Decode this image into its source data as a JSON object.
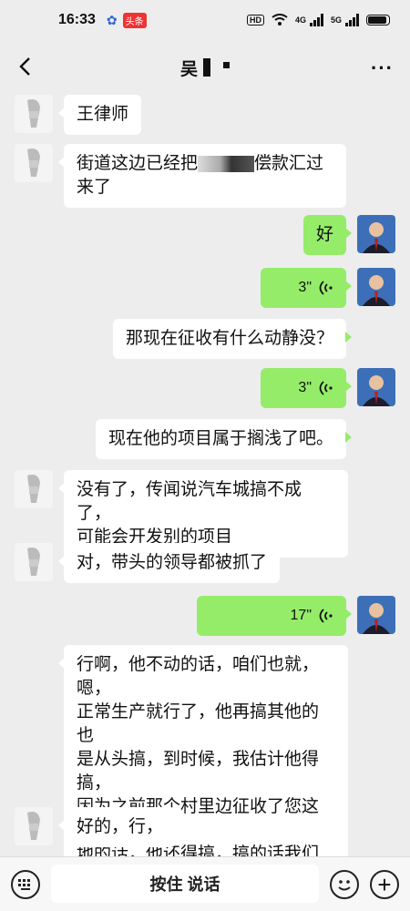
{
  "status_bar": {
    "time": "16:33",
    "app_badge": "头条",
    "network_1": "4G",
    "network_2": "5G",
    "hd_label": "HD"
  },
  "header": {
    "title": "吴"
  },
  "messages": [
    {
      "side": "left",
      "type": "text",
      "text": "王律师"
    },
    {
      "side": "left",
      "type": "text",
      "text": "街道这边已经把",
      "text_tail": "偿款汇过",
      "text_line2": "来了"
    },
    {
      "side": "right",
      "type": "text",
      "text": "好"
    },
    {
      "side": "right",
      "type": "voice",
      "duration": "3\""
    },
    {
      "side": "left",
      "type": "text",
      "text": "那现在征收有什么动静没？"
    },
    {
      "side": "right",
      "type": "voice",
      "duration": "3\""
    },
    {
      "side": "left",
      "type": "text",
      "text": "现在他的项目属于搁浅了吧。"
    },
    {
      "side": "left",
      "type": "text",
      "text": "没有了，传闻说汽车城搞不成了，\n可能会开发别的项目"
    },
    {
      "side": "left",
      "type": "text",
      "text": "对，带头的领导都被抓了"
    },
    {
      "side": "right",
      "type": "voice",
      "duration": "17\""
    },
    {
      "side": "left",
      "type": "text",
      "text": "行啊，他不动的话，咱们也就，嗯，\n正常生产就行了，他再搞其他的也\n是从头搞，到时候，我估计他得搞，\n因为之前那个村里边征收了您这个\n地的话，他还得搞，搞的话我们就\n从头应对就行了，不用担心。"
    },
    {
      "side": "left",
      "type": "text",
      "text": "好的，行，"
    }
  ],
  "input_bar": {
    "hold_to_talk_label": "按住 说话",
    "plus_label": "+"
  },
  "colors": {
    "background": "#ededed",
    "sent_bubble": "#95ec69",
    "received_bubble": "#ffffff"
  }
}
